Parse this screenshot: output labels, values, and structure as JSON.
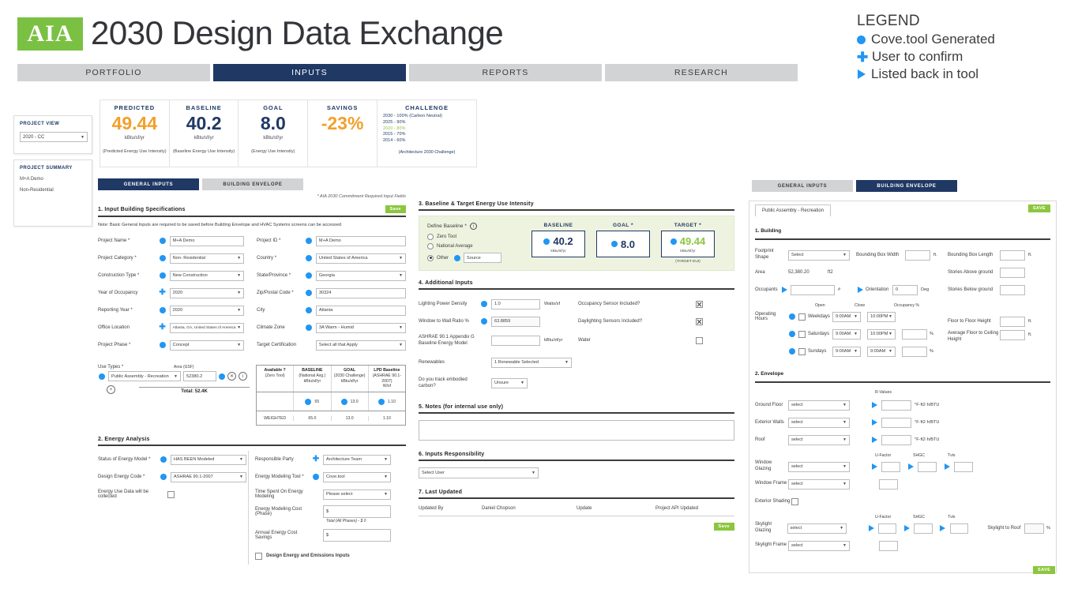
{
  "header": {
    "logo_text": "AIA",
    "title": "2030 Design Data Exchange",
    "tabs": [
      {
        "label": "PORTFOLIO",
        "active": false
      },
      {
        "label": "INPUTS",
        "active": true
      },
      {
        "label": "REPORTS",
        "active": false
      },
      {
        "label": "RESEARCH",
        "active": false
      }
    ]
  },
  "legend": {
    "title": "LEGEND",
    "items": [
      {
        "icon": "filled-circle-icon",
        "label": "Cove.tool Generated"
      },
      {
        "icon": "plus-icon",
        "label": "User to confirm"
      },
      {
        "icon": "play-triangle-icon",
        "label": "Listed back in tool"
      }
    ],
    "accent_color": "#2196f3"
  },
  "kpis": [
    {
      "label": "PREDICTED",
      "value": "49.44",
      "unit": "kBtu/sf/yr",
      "note": "(Predicted Energy Use Intensity)",
      "color": "#f2a02c"
    },
    {
      "label": "BASELINE",
      "value": "40.2",
      "unit": "kBtu/sf/yr",
      "note": "(Baseline Energy Use Intensity)",
      "color": "#1f3864"
    },
    {
      "label": "GOAL",
      "value": "8.0",
      "unit": "kBtu/sf/yr",
      "note": "(Energy Use Intensity)",
      "color": "#1f3864"
    },
    {
      "label": "SAVINGS",
      "value": "-23%",
      "unit": "",
      "note": "",
      "color": "#f2a02c"
    }
  ],
  "challenge": {
    "title": "CHALLENGE",
    "lines": [
      {
        "text": "2030 - 100% (Carbon Neutral)",
        "highlight": false
      },
      {
        "text": "2025 - 90%",
        "highlight": false
      },
      {
        "text": "2020 - 80%",
        "highlight": true
      },
      {
        "text": "2015 - 70%",
        "highlight": false
      },
      {
        "text": "2014 - 60%",
        "highlight": false
      }
    ],
    "footer": "(Architecture 2030 Challenge)"
  },
  "rail": {
    "project_view_title": "PROJECT VIEW",
    "project_view_value": "2020 - CC",
    "project_summary_title": "PROJECT SUMMARY",
    "project_summary_line1": "M+A Demo",
    "project_summary_line2": "Non-Residential"
  },
  "left_panel": {
    "subtabs": [
      {
        "label": "GENERAL INPUTS",
        "active": true
      },
      {
        "label": "BUILDING ENVELOPE",
        "active": false
      }
    ],
    "required_note": "* AIA 2030 Commitment Required Input Fields",
    "section1_title": "1. Input Building Specifications",
    "save_label": "Save",
    "note": "Note: Basic General Inputs are required to be saved before Building Envelope and HVAC Systems screens can be accessed",
    "fields": [
      {
        "label": "Project Name *",
        "marker": "dot",
        "value": "M+A Demo",
        "type": "text"
      },
      {
        "label": "Project ID *",
        "marker": "dot",
        "value": "M+A Demo",
        "type": "text"
      },
      {
        "label": "Project Category *",
        "marker": "dot",
        "value": "Non- Residential",
        "type": "select"
      },
      {
        "label": "Country *",
        "marker": "dot",
        "value": "United States of America",
        "type": "select"
      },
      {
        "label": "Construction Type *",
        "marker": "dot",
        "value": "New Construction",
        "type": "select"
      },
      {
        "label": "State/Province *",
        "marker": "dot",
        "value": "Georgia",
        "type": "select"
      },
      {
        "label": "Year of Occupancy",
        "marker": "plus",
        "value": "2020",
        "type": "select"
      },
      {
        "label": "Zip/Postal Code *",
        "marker": "dot",
        "value": "30324",
        "type": "text"
      },
      {
        "label": "Reporting Year *",
        "marker": "dot",
        "value": "2020",
        "type": "select"
      },
      {
        "label": "City",
        "marker": "dot",
        "value": "Atlanta",
        "type": "text"
      },
      {
        "label": "Office Location",
        "marker": "plus",
        "value": "Atlanta, GA, United States of America",
        "type": "select"
      },
      {
        "label": "Climate Zone",
        "marker": "dot",
        "value": "3A Warm - Humid",
        "type": "select"
      },
      {
        "label": "Project Phase *",
        "marker": "dot",
        "value": "Concept",
        "type": "select"
      },
      {
        "label": "Target Certification",
        "marker": "none",
        "value": "Select all that Apply",
        "type": "select"
      }
    ],
    "use_types": {
      "label": "Use Types *",
      "area_label": "Area (GSF)",
      "row_value": "Public Assembly - Recreation",
      "area_value": "52380.2",
      "total_label": "Total: 52.4K",
      "add_icon": "plus-circle-icon",
      "close_icon": "close-circle-icon",
      "info_icon": "info-circle-icon",
      "table_headers": [
        {
          "l1": "Available ?",
          "l2": "(Zero Tool)",
          "l3": ""
        },
        {
          "l1": "BASELINE",
          "l2": "(National Avg.)",
          "l3": "kBtu/sf/yr"
        },
        {
          "l1": "GOAL",
          "l2": "(2030 Challenge)",
          "l3": "kBtu/sf/yr"
        },
        {
          "l1": "LPD Baseline",
          "l2": "(ASHRAE 90.1-2007)",
          "l3": "W/sf"
        }
      ],
      "row_values": [
        "",
        "65",
        "13.0",
        "1.10"
      ],
      "weighted_label": "WEIGHTED",
      "weighted_values": [
        "65.0",
        "13.0",
        "1.10"
      ]
    },
    "section2_title": "2. Energy Analysis",
    "energy_fields_left": [
      {
        "label": "Status of Energy Model *",
        "marker": "dot",
        "value": "HAS BEEN Modeled",
        "type": "select"
      },
      {
        "label": "Design Energy Code *",
        "marker": "dot",
        "value": "ASHRAE 90.1-2007",
        "type": "select"
      }
    ],
    "energy_checkbox_label": "Energy Use Data will be collected",
    "energy_fields_right": [
      {
        "label": "Responsible Party",
        "marker": "plus",
        "value": "Architecture Team",
        "type": "select"
      },
      {
        "label": "Energy Modeling Tool *",
        "marker": "dot",
        "value": "Cove.tool",
        "type": "select"
      },
      {
        "label": "Time Spent On Energy Modeling",
        "marker": "none",
        "value": "Please select",
        "type": "select"
      },
      {
        "label": "Energy Modeling Cost (Phase)",
        "marker": "none",
        "value": "$",
        "type": "text"
      },
      {
        "label": "Annual Energy Cost Savings",
        "marker": "none",
        "value": "$",
        "type": "text"
      }
    ],
    "total_phases_note": "Total (All Phases) - $ 0",
    "design_emissions_label": "Design Energy and Emissions Inputs"
  },
  "mid_panel": {
    "section3_title": "3. Baseline & Target Energy Use Intensity",
    "define_baseline_label": "Define Baseline *",
    "info_icon": "info-circle-icon",
    "baseline_options": [
      {
        "label": "Zero Tool",
        "selected": false
      },
      {
        "label": "National Average",
        "selected": false
      },
      {
        "label": "Other",
        "selected": true
      }
    ],
    "source_placeholder": "Source",
    "cards": [
      {
        "label": "BASELINE",
        "value": "40.2",
        "unit": "kBtu/sf/yr",
        "sub": "",
        "green": false
      },
      {
        "label": "GOAL *",
        "value": "8.0",
        "unit": "",
        "sub": "",
        "green": false
      },
      {
        "label": "TARGET *",
        "value": "49.44",
        "unit": "kBtu/sf/yr",
        "sub": "(TARGET EUI)",
        "green": true
      }
    ],
    "section4_title": "4. Additional Inputs",
    "additional_left": [
      {
        "label": "Lighting Power Density",
        "marker": "dot",
        "value": "1.0",
        "unit": "Watts/sf"
      },
      {
        "label": "Window to Wall Ratio %",
        "marker": "dot",
        "value": "63.8859",
        "unit": ""
      },
      {
        "label": "ASHRAE 90.1 Appendix G Baseline Energy Model",
        "marker": "none",
        "value": "",
        "unit": "kBtu/sf/yr"
      }
    ],
    "renewables_label": "Renewables",
    "renewables_value": "1 Renewable Selected",
    "embodied_label": "Do you track embodied carbon?",
    "embodied_value": "Unsure",
    "additional_right": [
      {
        "label": "Occupancy Sensor Included?",
        "checked": true
      },
      {
        "label": "Daylighting Sensors Included?",
        "checked": true
      },
      {
        "label": "Water",
        "checked": false
      }
    ],
    "section5_title": "5. Notes (for internal use only)",
    "notes_value": "",
    "section6_title": "6. Inputs Responsibility",
    "user_select_value": "Select User",
    "section7_title": "7. Last Updated",
    "last_updated": {
      "updated_by_label": "Updated By",
      "updated_by_value": "Daniel Chopson",
      "update_label": "Update",
      "update_value": "Project API Updated"
    },
    "save_label": "Save"
  },
  "right_panel": {
    "subtabs": [
      {
        "label": "GENERAL INPUTS",
        "active": false
      },
      {
        "label": "BUILDING ENVELOPE",
        "active": true
      }
    ],
    "entity_tab": "Public Assembly - Recreation",
    "save_label": "SAVE",
    "save_label_bottom": "SAVE",
    "section1_title": "1. Building",
    "footprint_label": "Footprint Shape",
    "footprint_value": "Select",
    "area_label": "Area",
    "area_value": "52,380.20",
    "area_unit": "ft2",
    "occupants_label": "Occupants",
    "occupants_unit": "#",
    "bbox_width_label": "Bounding Box Width",
    "bbox_width_unit": "ft.",
    "bbox_length_label": "Bounding Box Length",
    "bbox_length_unit": "ft.",
    "stories_above_label": "Stories Above ground",
    "stories_below_label": "Stories Below ground",
    "orientation_label": "Orientation",
    "orientation_value": "0",
    "orientation_unit": "Deg",
    "floor_to_floor_label": "Floor to Floor Height",
    "floor_to_floor_unit": "ft.",
    "floor_to_ceiling_label": "Average Floor to Ceiling Height",
    "floor_to_ceiling_unit": "ft.",
    "operating_hours_label": "Operating Hours",
    "hours_headers": {
      "open": "Open",
      "close": "Close",
      "occupancy": "Occupancy %"
    },
    "hours_rows": [
      {
        "day": "Weekdays",
        "open": "9:00AM",
        "close": "10:00PM",
        "occupancy": "",
        "show_occ": false
      },
      {
        "day": "Saturdays",
        "open": "9:00AM",
        "close": "10:00PM",
        "occupancy": "",
        "show_occ": true
      },
      {
        "day": "Sundays",
        "open": "9:00AM",
        "close": "9:00AM",
        "occupancy": "",
        "show_occ": true
      }
    ],
    "section2_title": "2. Envelope",
    "rvalues_header": "R-Values",
    "rvalue_unit": "°F·ft2·h/BTU",
    "envelope_rows": [
      {
        "label": "Ground Floor",
        "value": "select"
      },
      {
        "label": "Exterior Walls",
        "value": "select"
      },
      {
        "label": "Roof",
        "value": "select"
      }
    ],
    "glazing_headers": {
      "u": "U-Factor",
      "shgc": "SHGC",
      "tvis": "Tvis"
    },
    "window_glazing_label": "Window Glazing",
    "window_glazing_value": "select",
    "window_frame_label": "Window Frame",
    "window_frame_value": "select",
    "exterior_shading_label": "Exterior Shading",
    "skylight_glazing_label": "Skylight Glazing",
    "skylight_glazing_value": "select",
    "skylight_frame_label": "Skylight Frame",
    "skylight_frame_value": "select",
    "skylight_to_roof_label": "Skylight to Roof",
    "skylight_to_roof_unit": "%",
    "select_placeholder": "select"
  }
}
